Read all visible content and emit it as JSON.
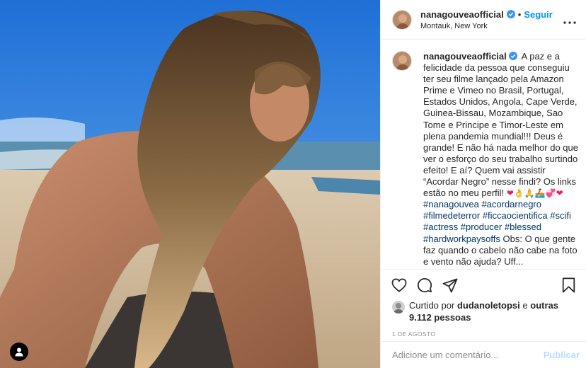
{
  "post": {
    "username": "nanagouveaofficial",
    "verified": true,
    "separator": "•",
    "follow_label": "Seguir",
    "location": "Montauk, New York",
    "more_options_icon": "ellipsis-icon",
    "photo_alt": "Praia",
    "user_tag_icon": "person-icon"
  },
  "caption": {
    "username": "nanagouveaofficial",
    "text_1": "A paz e a felicidade da pessoa que conseguiu ter seu filme lançado pela Amazon Prime e Vimeo no Brasil, Portugal, Estados Unidos, Angola, Cape Verde, Guinea-Bissau, Mozambique, Sao Tome e Principe e Timor-Leste em plena pandemia mundial!!! Deus é grande! E não há nada melhor do que ver o esforço do seu trabalho surtindo efeito! E aí? Quem vai assistir “Acordar Negro” nesse findi? Os links estão no meu perfil!",
    "emojis": "❤👌🙏🚣💞❤",
    "hashtags_1": [
      "#nanagouvea",
      "#acordarnegro",
      "#filmedeterror",
      "#ficcaocientifica",
      "#scifi",
      "#actress",
      "#producer",
      "#blessed",
      "#hardworkpaysoffs"
    ],
    "text_2": "Obs: O que gente faz quando o cabelo não cabe na foto e vento não ajuda? Uff..."
  },
  "actions": {
    "like_icon": "heart-icon",
    "comment_icon": "comment-icon",
    "share_icon": "paper-plane-icon",
    "save_icon": "bookmark-icon"
  },
  "likes": {
    "prefix": "Curtido por",
    "liker": "dudanoletopsi",
    "middle": "e",
    "others": "outras 9.112 pessoas"
  },
  "date": "1 de agosto",
  "comment": {
    "placeholder": "Adicione um comentário...",
    "publish_label": "Publicar"
  },
  "colors": {
    "link_blue": "#0095f6",
    "hashtag": "#00376b",
    "muted": "#8e8e8e",
    "publish_disabled": "#b2dffc",
    "verified_badge": "#3897f0"
  }
}
